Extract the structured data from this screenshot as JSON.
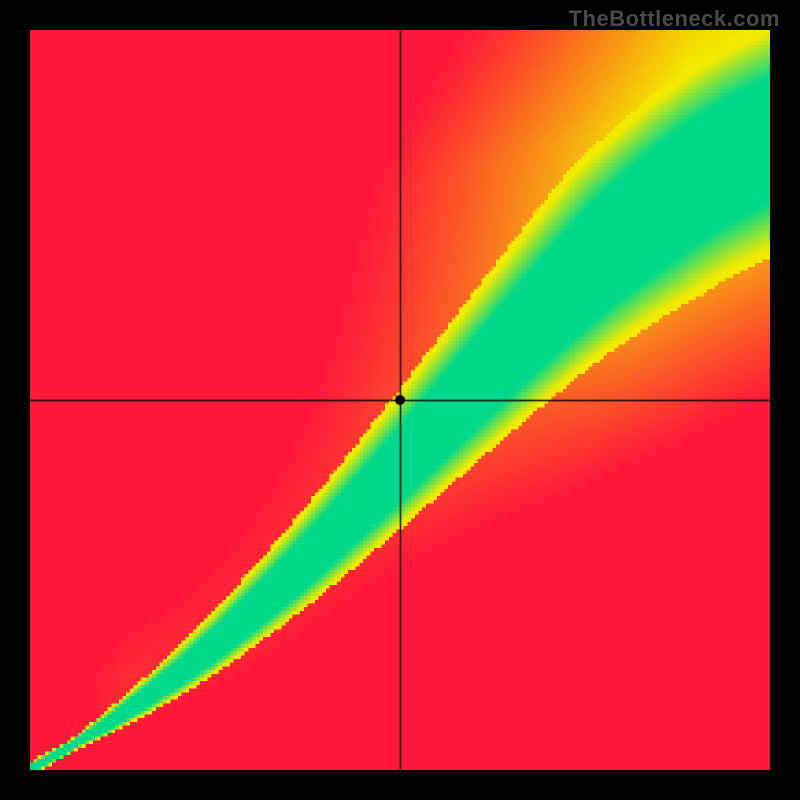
{
  "watermark": "TheBottleneck.com",
  "chart_data": {
    "type": "heatmap",
    "title": "",
    "xlabel": "",
    "ylabel": "",
    "xlim": [
      0,
      1
    ],
    "ylim": [
      0,
      1
    ],
    "grid_resolution": 200,
    "crosshair": {
      "x": 0.5,
      "y": 0.5
    },
    "marker": {
      "x": 0.5,
      "y": 0.5,
      "radius_px": 5
    },
    "ridge": {
      "description": "Curve of optimal-match points; green band centers on this ridge",
      "points": [
        [
          0.0,
          0.0
        ],
        [
          0.05,
          0.028
        ],
        [
          0.1,
          0.058
        ],
        [
          0.15,
          0.092
        ],
        [
          0.2,
          0.128
        ],
        [
          0.25,
          0.168
        ],
        [
          0.3,
          0.212
        ],
        [
          0.35,
          0.258
        ],
        [
          0.4,
          0.307
        ],
        [
          0.45,
          0.358
        ],
        [
          0.5,
          0.41
        ],
        [
          0.55,
          0.463
        ],
        [
          0.6,
          0.517
        ],
        [
          0.65,
          0.57
        ],
        [
          0.7,
          0.622
        ],
        [
          0.75,
          0.672
        ],
        [
          0.8,
          0.718
        ],
        [
          0.85,
          0.76
        ],
        [
          0.9,
          0.797
        ],
        [
          0.95,
          0.828
        ],
        [
          1.0,
          0.852
        ]
      ]
    },
    "green_band_halfwidth_at_1": 0.085,
    "yellow_band_halfwidth_at_1": 0.16,
    "color_stops": {
      "optimal": "#00d98b",
      "near": "#f2ea00",
      "orange": "#ff8a00",
      "worst": "#ff1a3a"
    }
  }
}
